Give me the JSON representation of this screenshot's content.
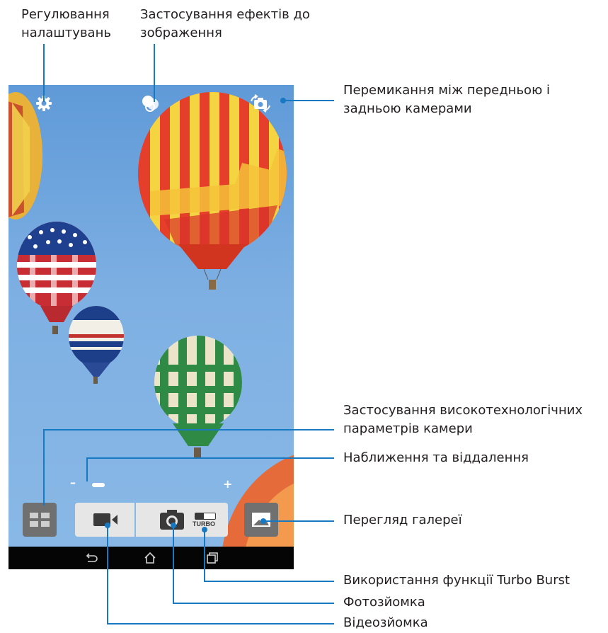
{
  "callouts": {
    "settings": "Регулювання\nналаштувань",
    "effects": "Застосування ефектів до\nзображення",
    "switch_camera": "Перемикання між передньою і\nзадньою камерами",
    "advanced": "Застосування високотехнологічних\nпараметрів камери",
    "zoom": "Наближення та віддалення",
    "gallery": "Перегляд галереї",
    "turbo_burst": "Використання функції Turbo Burst",
    "photo": "Фотозйомка",
    "video": "Відеозйомка"
  },
  "camera": {
    "turbo_label": "TURBO",
    "zoom_minus": "–",
    "zoom_plus": "+",
    "zoom_level": 0.08
  },
  "icons": {
    "settings": "gear-icon",
    "effects": "overlapping-circles-icon",
    "switch": "camera-switch-icon",
    "modes": "grid-icon",
    "video": "video-camera-icon",
    "photo": "camera-icon",
    "gallery": "gallery-icon",
    "back": "back-arrow-icon",
    "home": "home-icon",
    "recents": "recent-apps-icon"
  },
  "colors": {
    "callout_line": "#1779c2",
    "sky": "#7fb0e3",
    "button_bg": "#e6e6e6",
    "navbar": "#050505"
  }
}
